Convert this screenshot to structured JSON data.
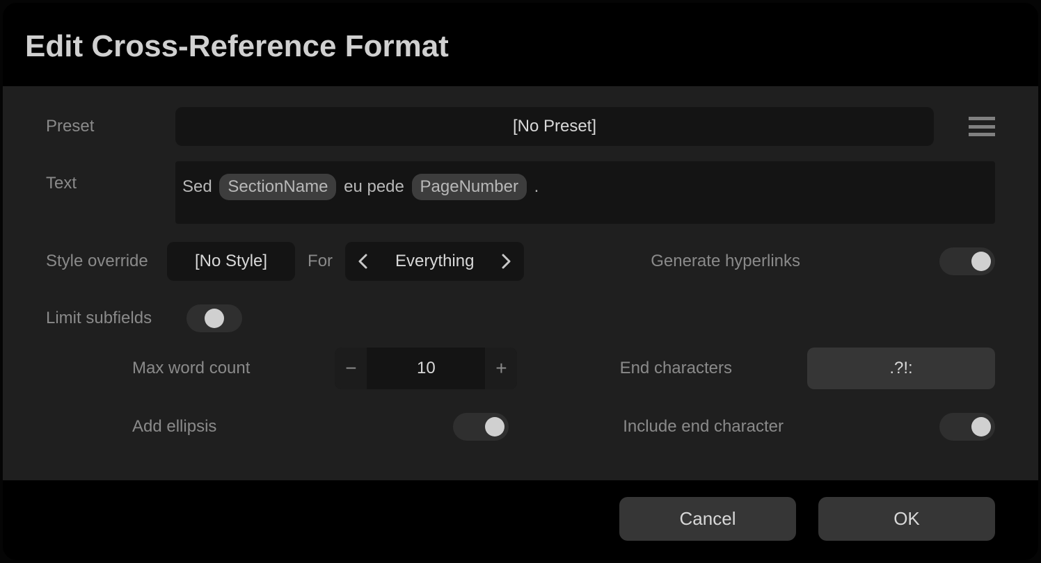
{
  "dialog": {
    "title": "Edit Cross-Reference Format"
  },
  "labels": {
    "preset": "Preset",
    "text": "Text",
    "style_override": "Style override",
    "for": "For",
    "generate_hyperlinks": "Generate hyperlinks",
    "limit_subfields": "Limit subfields",
    "max_word_count": "Max word count",
    "end_characters": "End characters",
    "add_ellipsis": "Add ellipsis",
    "include_end_character": "Include end character"
  },
  "values": {
    "preset": "[No Preset]",
    "text_prefix": "Sed ",
    "text_token1": "SectionName",
    "text_middle": " eu pede ",
    "text_token2": "PageNumber",
    "text_suffix": " .",
    "style": "[No Style]",
    "for_value": "Everything",
    "max_word_count": "10",
    "end_characters": ".?!:"
  },
  "toggles": {
    "generate_hyperlinks": true,
    "limit_subfields": false,
    "add_ellipsis": true,
    "include_end_character": true
  },
  "buttons": {
    "cancel": "Cancel",
    "ok": "OK",
    "minus": "−",
    "plus": "+"
  }
}
